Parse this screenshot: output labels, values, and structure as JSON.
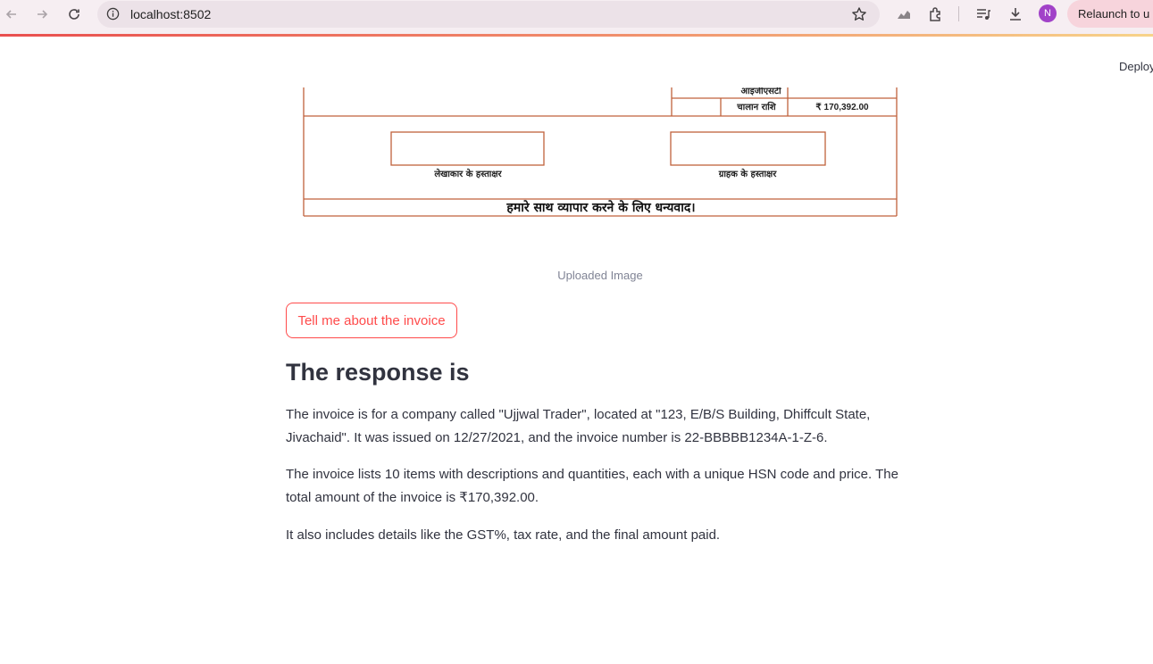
{
  "browser": {
    "url": "localhost:8502",
    "avatar_letter": "N",
    "relaunch_label": "Relaunch to u"
  },
  "app": {
    "deploy_label": "Deploy",
    "invoice_image": {
      "row_label_top": "आइजीएसटी",
      "invoice_amount_label": "चालान राशि",
      "invoice_amount_value": "₹ 170,392.00",
      "accountant_signature": "लेखाकार के हस्ताक्षर",
      "customer_signature": "ग्राहक के हस्ताक्षर",
      "thank_you": "हमारे साथ व्यापार करने के लिए धन्यवाद।"
    },
    "image_caption": "Uploaded Image",
    "tell_button_label": "Tell me about the invoice",
    "response_heading": "The response is",
    "paragraphs": [
      "The invoice is for a company called \"Ujjwal Trader\", located at \"123, E/B/S Building, Dhiffcult State, Jivachaid\". It was issued on 12/27/2021, and the invoice number is 22-BBBBB1234A-1-Z-6.",
      "The invoice lists 10 items with descriptions and quantities, each with a unique HSN code and price. The total amount of the invoice is ₹170,392.00.",
      "It also includes details like the GST%, tax rate, and the final amount paid."
    ]
  },
  "colors": {
    "accent": "#ff4b4b",
    "invoice_border": "#c0623c"
  }
}
